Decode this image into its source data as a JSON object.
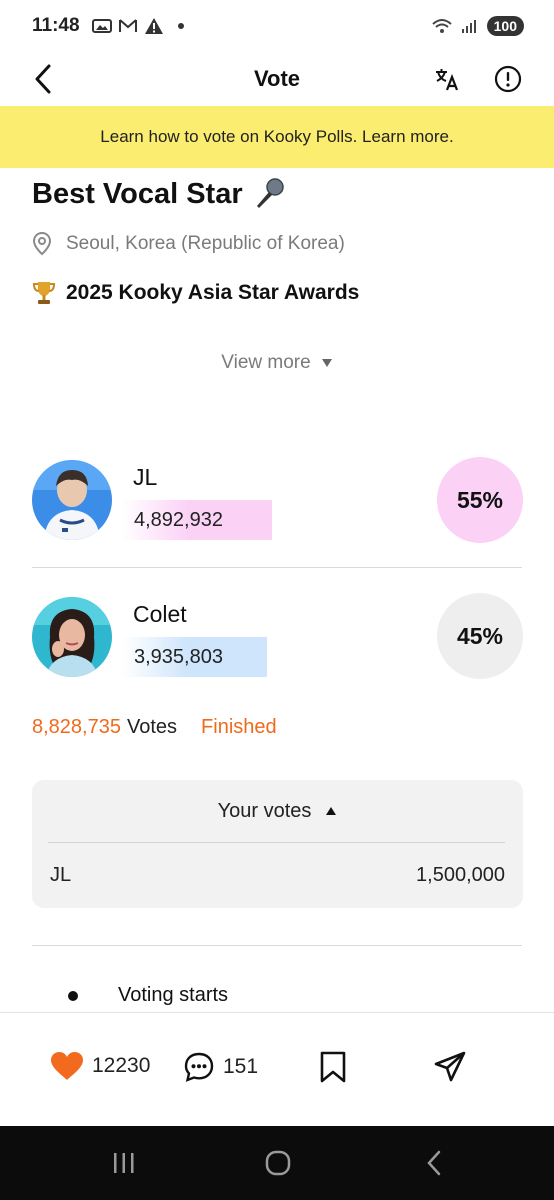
{
  "status_bar": {
    "time": "11:48",
    "battery": "100"
  },
  "header": {
    "title": "Vote"
  },
  "banner": {
    "text": "Learn how to vote on Kooky Polls. Learn more."
  },
  "poll": {
    "title": "Best Vocal Star",
    "location": "Seoul, Korea (Republic of Korea)",
    "event": "2025 Kooky Asia Star Awards",
    "view_more": "View more"
  },
  "candidates": [
    {
      "name": "JL",
      "votes": "4,892,932",
      "percent": "55%",
      "share": 0.55,
      "accent": "#fbd1f6"
    },
    {
      "name": "Colet",
      "votes": "3,935,803",
      "percent": "45%",
      "share": 0.45,
      "accent": "#cfe5fb"
    }
  ],
  "totals": {
    "count": "8,828,735",
    "label": "Votes",
    "status": "Finished"
  },
  "your_votes": {
    "header": "Your votes",
    "rows": [
      {
        "name": "JL",
        "value": "1,500,000"
      }
    ]
  },
  "timeline": {
    "first_item": "Voting starts"
  },
  "actions": {
    "likes": "12230",
    "comments": "151"
  },
  "colors": {
    "accent_orange": "#f06a1c",
    "banner_yellow": "#fbed6f"
  }
}
